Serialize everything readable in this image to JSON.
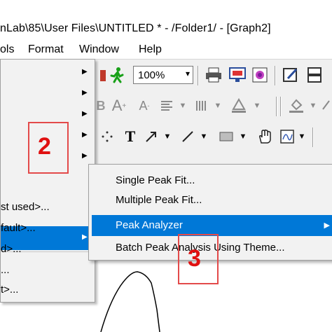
{
  "window": {
    "title": "nLab\\85\\User Files\\UNTITLED * - /Folder1/ - [Graph2]"
  },
  "menubar": {
    "items": [
      "ols",
      "Format",
      "Window",
      "Help"
    ]
  },
  "toolbar": {
    "zoom": "100%",
    "zoom_arrow": "▾"
  },
  "menu1": {
    "items": [
      "st used>...",
      "fault>...",
      "d>...",
      "...",
      "t>..."
    ]
  },
  "submenu": {
    "items": [
      "Single Peak Fit...",
      "Multiple Peak Fit...",
      "Peak Analyzer",
      "Batch Peak Analysis Using Theme..."
    ],
    "highlight_color": "#0078d7"
  },
  "annotations": {
    "step2": "2",
    "step3": "3",
    "color": "#e01010"
  }
}
